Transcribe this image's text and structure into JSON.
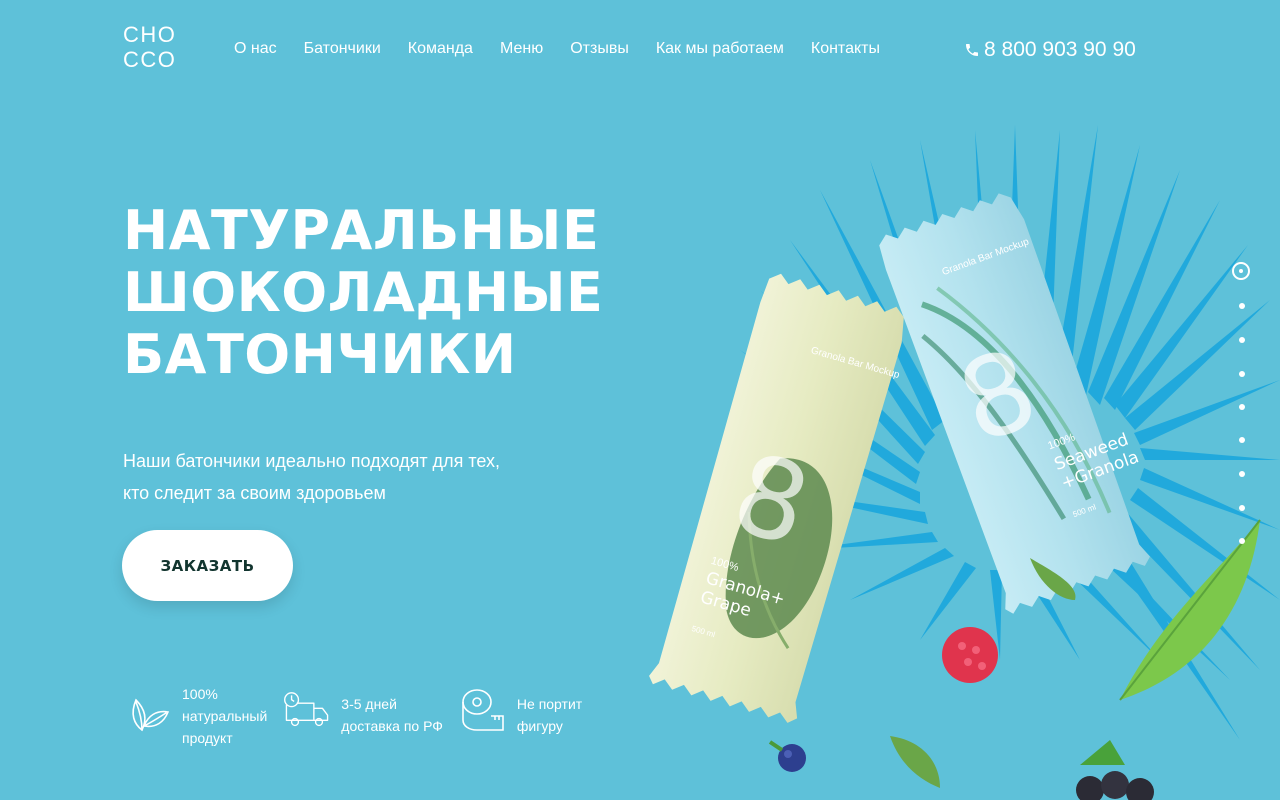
{
  "header": {
    "logo": "CHO\nCCO",
    "nav": [
      "О нас",
      "Батончики",
      "Команда",
      "Меню",
      "Отзывы",
      "Как мы работаем",
      "Контакты"
    ],
    "phone": "8 800 903 90 90"
  },
  "hero": {
    "title_line1": "НАТУРАЛЬНЫЕ",
    "title_line2": "ШОКОЛАДНЫЕ",
    "title_line3": "БАТОНЧИКИ",
    "subtitle": "Наши батончики идеально подходят для тех, кто следит за своим здоровьем",
    "order_button": "ЗАКАЗАТЬ"
  },
  "features": [
    {
      "icon": "leaf-icon",
      "text": "100%\nнатуральный\nпродукт"
    },
    {
      "icon": "delivery-truck-icon",
      "text": "3-5 дней\nдоставка по РФ"
    },
    {
      "icon": "measuring-tape-icon",
      "text": "Не портит\nфигуру"
    }
  ],
  "products": {
    "bar1": {
      "brand": "Granola Bar\nMockup",
      "number": "8",
      "percent": "100%",
      "name_line1": "Granola+",
      "name_line2": "Grape",
      "volume": "500 ml"
    },
    "bar2": {
      "brand": "Granola Bar\nMockup",
      "number": "8",
      "percent": "100%",
      "name_line1": "Seaweed",
      "name_line2": "+Granola",
      "volume": "500 ml"
    }
  },
  "slider": {
    "count": 9,
    "active_index": 0
  },
  "colors": {
    "background": "#5ec1d9",
    "button_text": "#12352f",
    "palm": "#21a9dc",
    "bar1": "#e9ecc8",
    "bar2": "#b6e3ef"
  }
}
